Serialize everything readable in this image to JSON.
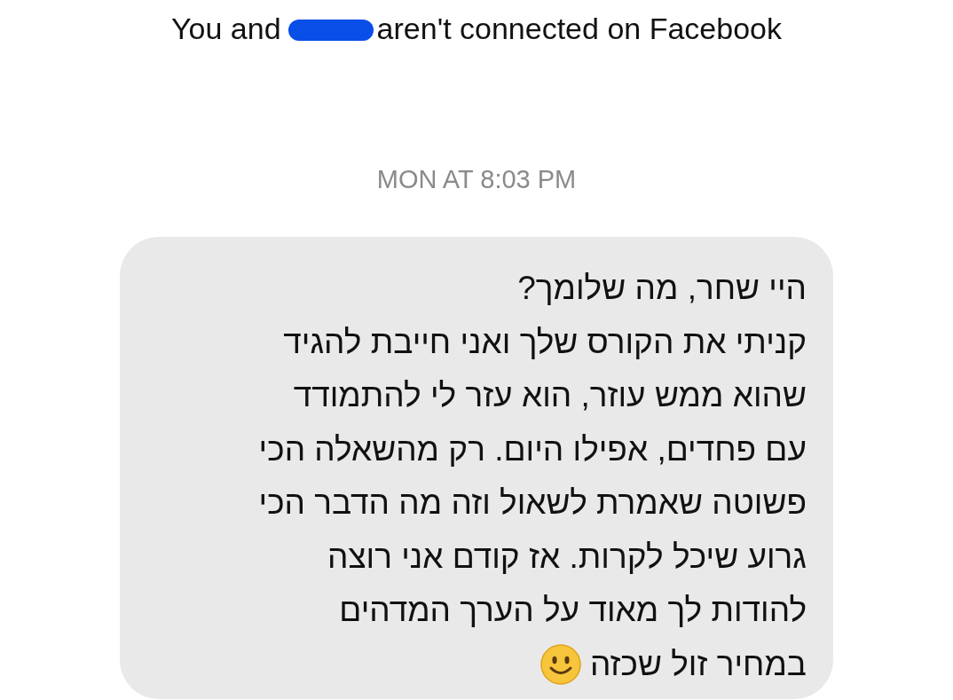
{
  "notice": {
    "before": "You and",
    "redacted": true,
    "after": "aren't connected on Facebook"
  },
  "timestamp": "MON AT 8:03 PM",
  "message": {
    "lines": [
      "היי שחר, מה שלומך?",
      "קניתי את הקורס שלך ואני חייבת להגיד",
      "שהוא ממש עוזר, הוא עזר לי להתמודד",
      "עם פחדים, אפילו היום. רק מהשאלה הכי",
      "פשוטה שאמרת לשאול וזה מה הדבר הכי",
      "גרוע שיכל לקרות. אז קודם אני רוצה",
      "להודות לך מאוד על הערך המדהים"
    ],
    "last_line": "במחיר זול שכזה"
  }
}
